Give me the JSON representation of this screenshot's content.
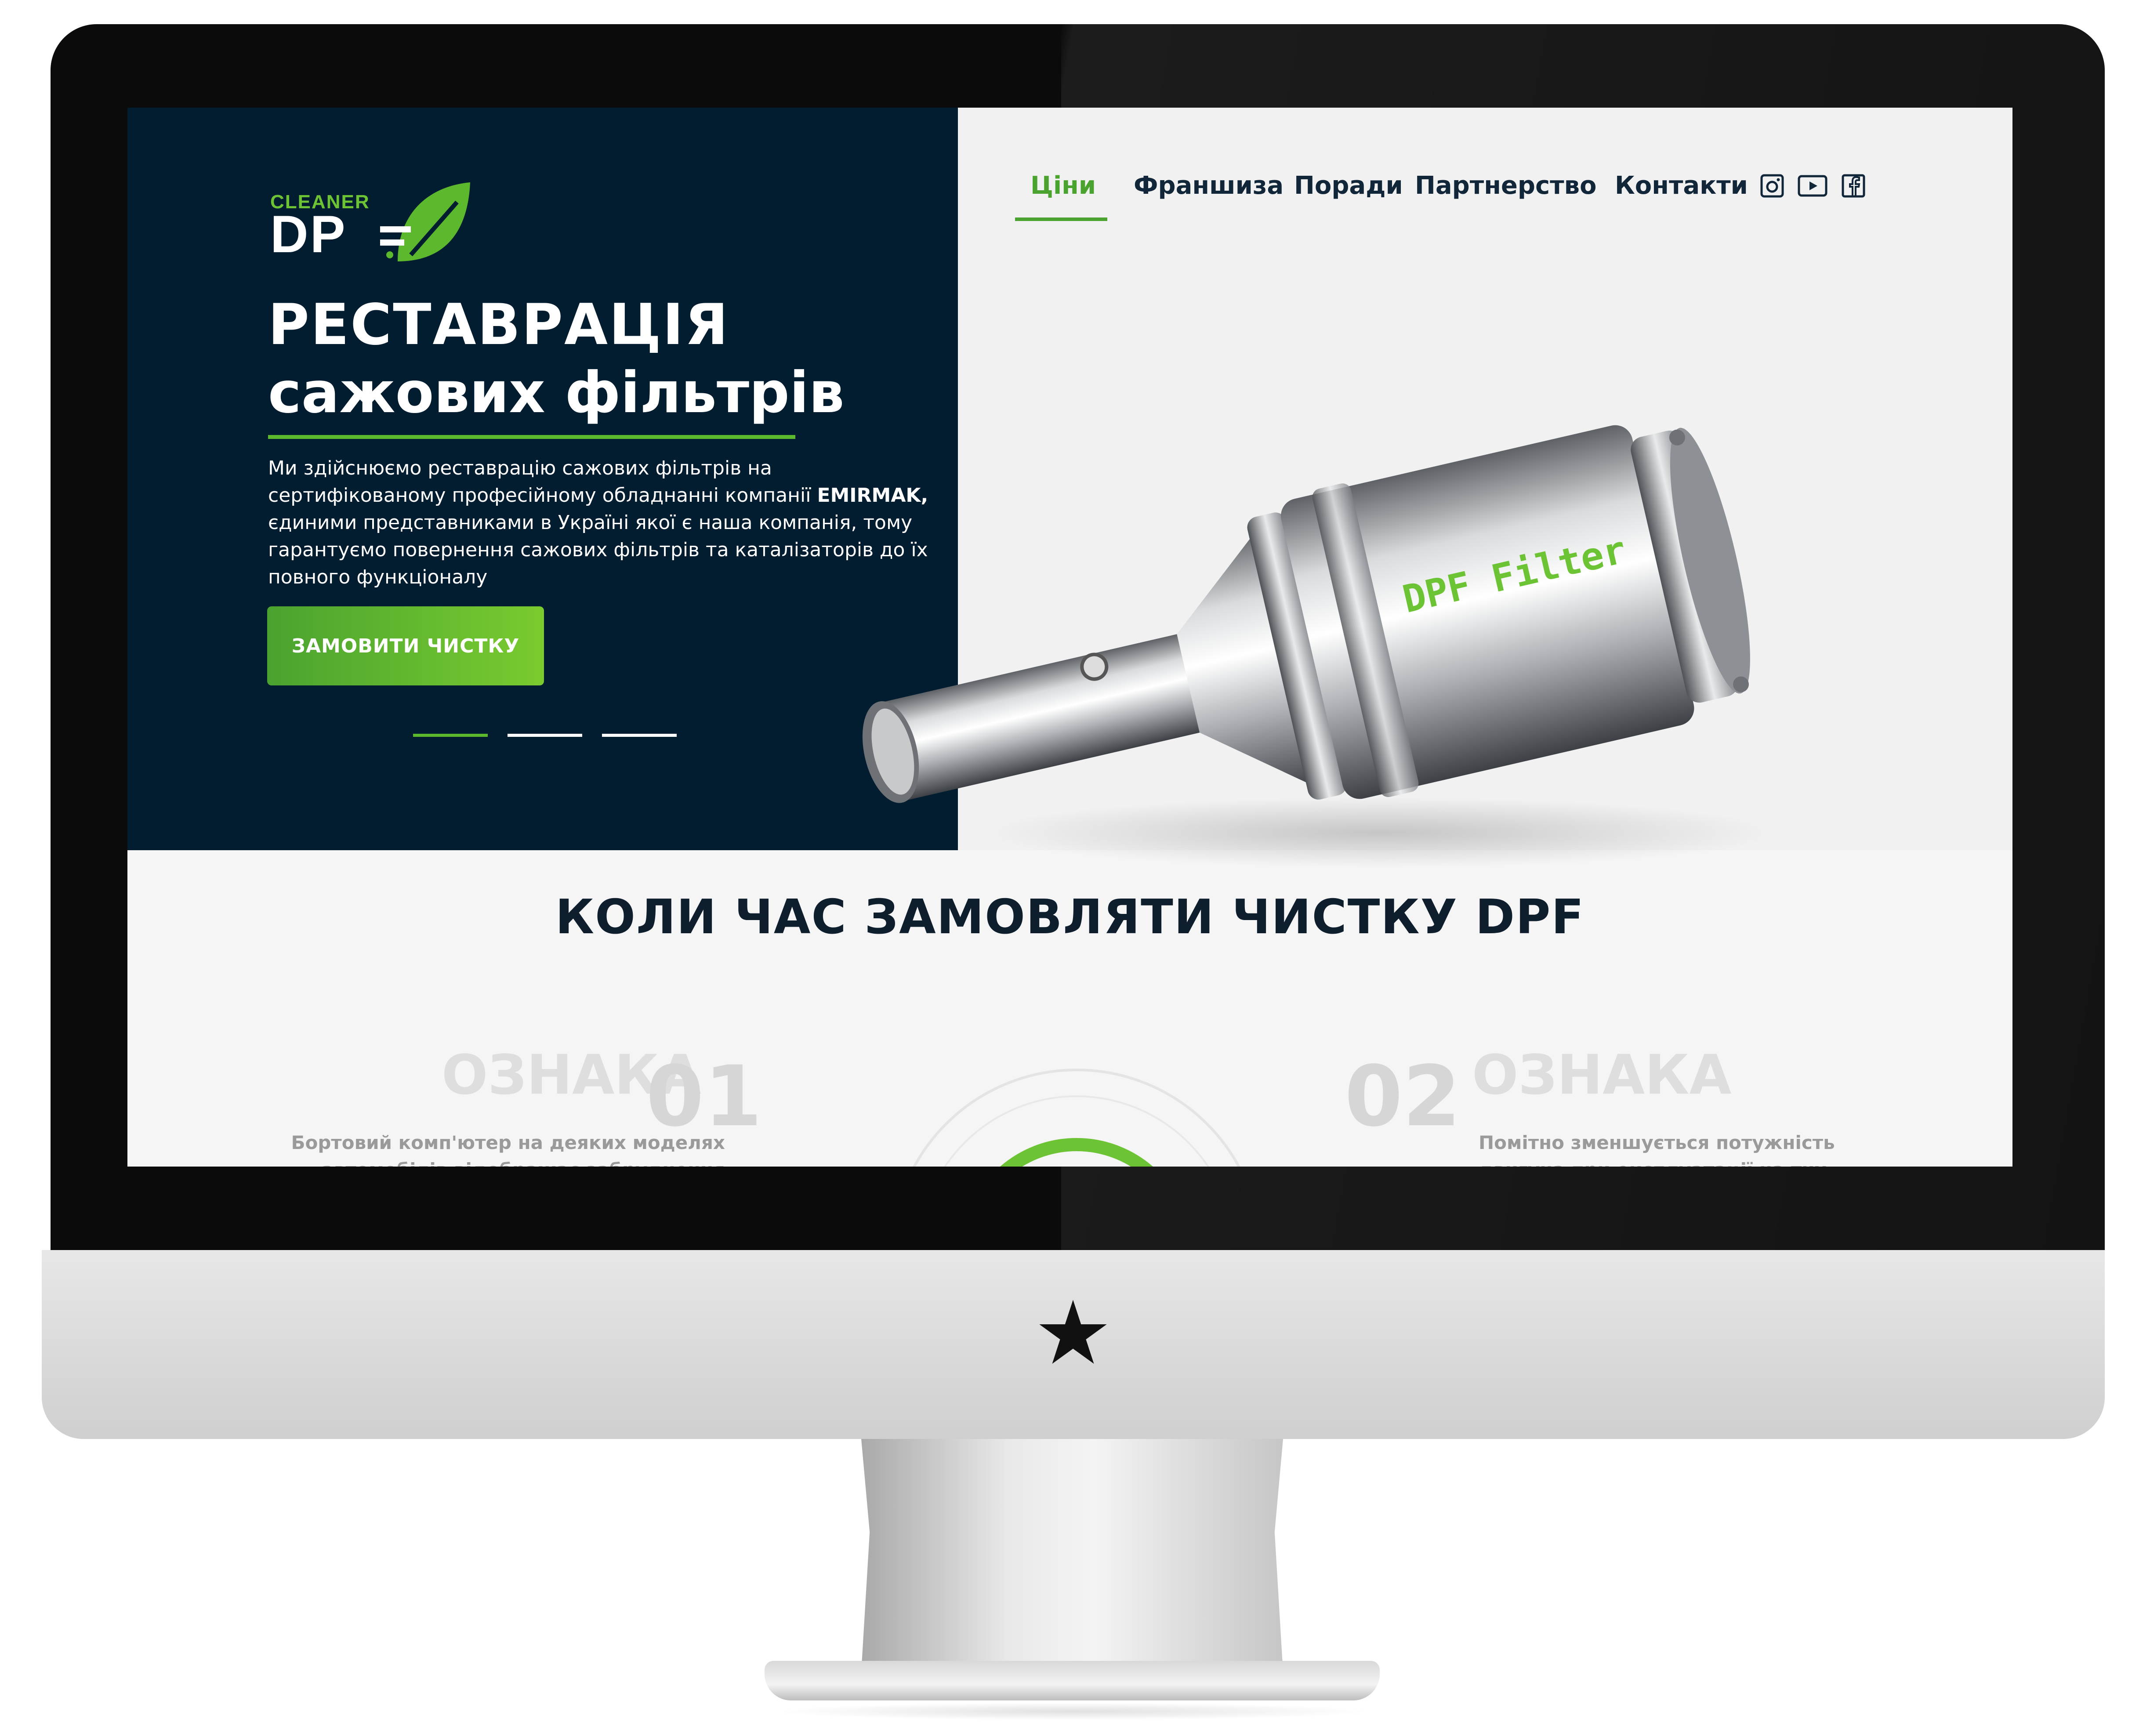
{
  "brand": {
    "logo_small": "CLEANER",
    "logo_main": "DP"
  },
  "nav": {
    "items": [
      {
        "label": "Ціни",
        "active": true
      },
      {
        "label": "Франшиза",
        "active": false
      },
      {
        "label": "Поради",
        "active": false
      },
      {
        "label": "Партнерство",
        "active": false
      },
      {
        "label": "Контакти",
        "active": false
      }
    ],
    "social": [
      "instagram-icon",
      "youtube-icon",
      "facebook-icon"
    ]
  },
  "hero": {
    "title_line1": "РЕСТАВРАЦІЯ",
    "title_line2": "сажових фільтрів",
    "description_pre": "Ми здійснюємо реставрацію сажових фільтрів на сертифікованому професійному обладнанні компанії ",
    "description_brand": "EMIRMAK,",
    "description_post": " єдиними представниками в Україні якої є наша компанія, тому гарантуємо повернення сажових фільтрів та каталізаторів до їх повного функціоналу",
    "cta_label": "ЗАМОВИТИ ЧИСТКУ",
    "slides_total": 3,
    "slide_active": 1,
    "product_label": "DPF  Filter"
  },
  "section": {
    "title": "КОЛИ ЧАС ЗАМОВЛЯТИ ЧИСТКУ DPF",
    "signs": [
      {
        "label": "ОЗНАКА",
        "number": "01",
        "text_line1": "Бортовий комп'ютер на деяких моделях",
        "text_line2": "автомобілів відображає забруднення"
      },
      {
        "label": "ОЗНАКА",
        "number": "02",
        "text_line1": "Помітно зменшується потужність",
        "text_line2": "двигуна при експлуатації на тих"
      }
    ]
  },
  "colors": {
    "hero_bg": "#021d30",
    "accent": "#5cb82c",
    "nav_text": "#12263a"
  }
}
